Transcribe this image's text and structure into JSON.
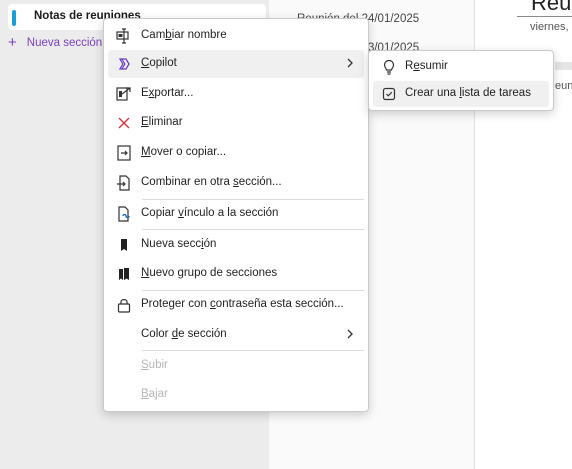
{
  "sections": {
    "active_section": "Notas de reuniones",
    "add_section_label": "Nueva sección",
    "marker_color": "#1b9fd6",
    "add_color": "#7a3fbf"
  },
  "pages": {
    "entries": [
      "Reunión del 24/01/2025",
      "Reunión del 23/01/2025"
    ]
  },
  "canvas": {
    "title": "Reu",
    "date": "viernes,",
    "peek_text": "eun"
  },
  "context_menu": {
    "items": [
      {
        "pre": "Cam",
        "key": "b",
        "post": "iar nombre",
        "icon": "rename-icon"
      },
      {
        "pre": "",
        "key": "C",
        "post": "opilot",
        "icon": "copilot-icon"
      },
      {
        "pre": "E",
        "key": "x",
        "post": "portar...",
        "icon": "export-icon"
      },
      {
        "pre": "",
        "key": "E",
        "post": "liminar",
        "icon": "delete-icon"
      },
      {
        "pre": "",
        "key": "M",
        "post": "over o copiar...",
        "icon": "move-copy-icon"
      },
      {
        "pre": "Combinar en otra ",
        "key": "s",
        "post": "ección...",
        "icon": "merge-icon"
      },
      {
        "pre": "Copiar ",
        "key": "v",
        "post": "ínculo a la sección",
        "icon": "link-icon"
      },
      {
        "pre": "Nueva secc",
        "key": "i",
        "post": "ón",
        "icon": "new-section-icon"
      },
      {
        "pre": "",
        "key": "N",
        "post": "uevo grupo de secciones",
        "icon": "new-section-group-icon"
      },
      {
        "pre": "Proteger con ",
        "key": "c",
        "post": "ontraseña esta sección...",
        "icon": "lock-icon"
      },
      {
        "pre": "Color ",
        "key": "d",
        "post": "e sección",
        "icon": "none"
      },
      {
        "pre": "",
        "key": "S",
        "post": "ubir",
        "icon": "none"
      },
      {
        "pre": "",
        "key": "B",
        "post": "ajar",
        "icon": "none"
      }
    ]
  },
  "submenu": {
    "items": [
      {
        "pre": "R",
        "key": "e",
        "post": "sumir",
        "icon": "lightbulb-icon"
      },
      {
        "pre": "Crear una ",
        "key": "l",
        "post": "ista de tareas",
        "icon": "checkbox-icon"
      }
    ]
  }
}
